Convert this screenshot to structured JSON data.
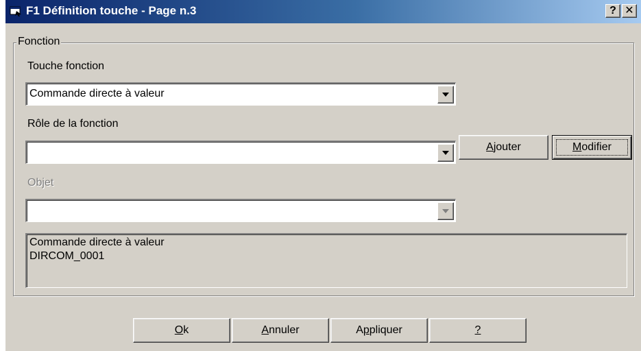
{
  "window": {
    "title": "F1 Définition touche - Page n.3",
    "help_button": "?",
    "close_button": "✕"
  },
  "group": {
    "legend": "Fonction",
    "touche_label": "Touche fonction",
    "touche_value": "Commande directe à valeur",
    "role_label": "Rôle de la fonction",
    "role_value": "",
    "objet_label": "Objet",
    "objet_value": "",
    "add_button": {
      "mnemonic": "A",
      "rest": "jouter"
    },
    "modify_button": {
      "mnemonic": "M",
      "rest": "odifier"
    },
    "info_lines": [
      "Commande directe à valeur",
      "DIRCOM_0001"
    ]
  },
  "footer": {
    "ok": {
      "mnemonic": "O",
      "rest": "k"
    },
    "cancel": {
      "mnemonic": "A",
      "rest": "nnuler"
    },
    "apply": {
      "pre": "A",
      "mnemonic": "p",
      "rest": "pliquer"
    },
    "help": {
      "mnemonic": "?",
      "rest": ""
    }
  },
  "colors": {
    "face": "#d4d0c8",
    "title_start": "#0a246a",
    "title_end": "#a6caf0",
    "disabled_text": "#808080"
  },
  "icons": {
    "title": "app-window-icon",
    "combo_arrow": "chevron-down-icon"
  }
}
